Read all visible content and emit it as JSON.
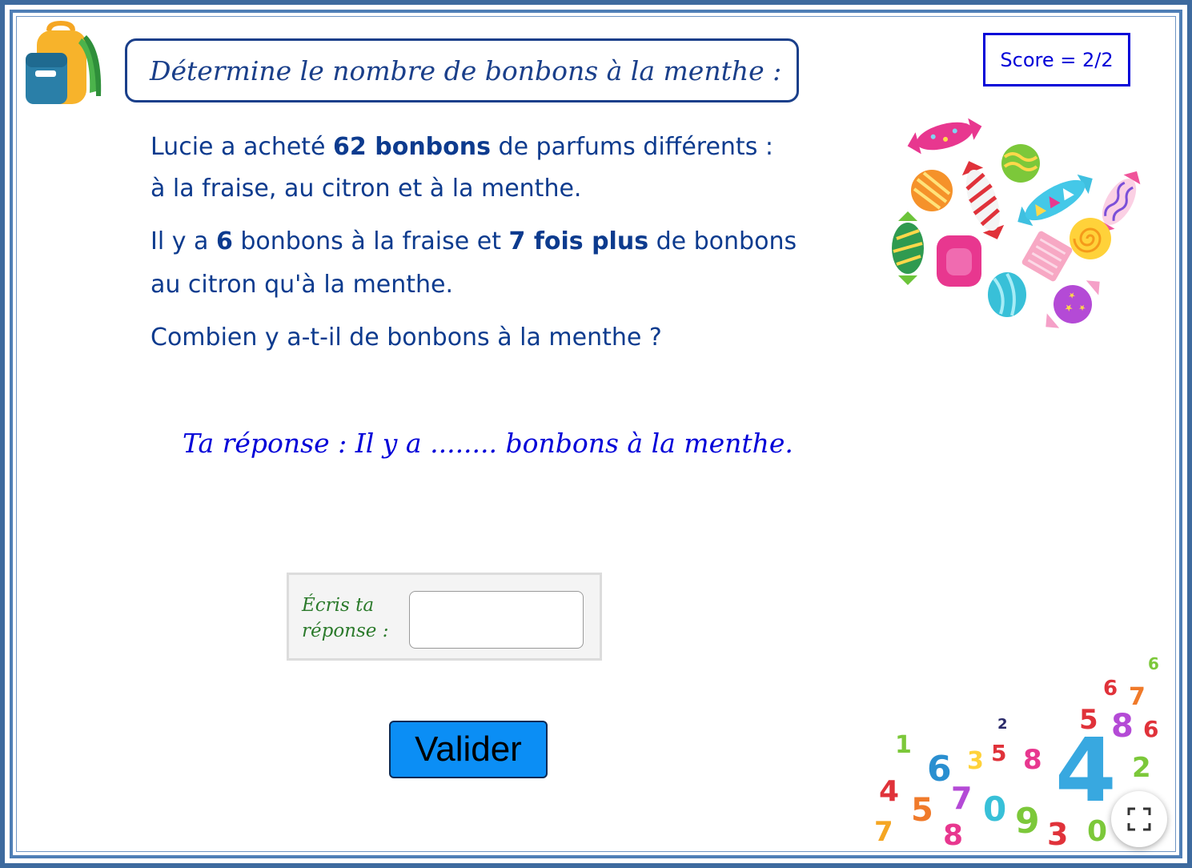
{
  "header": {
    "title": "Détermine le nombre de bonbons à la menthe :"
  },
  "score": {
    "label": "Score = 2/2"
  },
  "problem": {
    "line1_pre": "Lucie a acheté ",
    "line1_bold": "62 bonbons",
    "line1_post": " de parfums différents :",
    "line2": "à la fraise, au citron et à la menthe.",
    "line3_pre": "Il y a ",
    "line3_bold1": "6",
    "line3_mid": " bonbons à la fraise et ",
    "line3_bold2": "7 fois plus",
    "line3_post": " de bonbons",
    "line4": "au citron qu'à la menthe.",
    "line5": "Combien y a-t-il de bonbons à la menthe ?"
  },
  "answer_sentence": "Ta réponse : Il y a ........ bonbons à la menthe.",
  "input": {
    "label_line1": "Écris ta",
    "label_line2": "réponse :",
    "value": ""
  },
  "buttons": {
    "validate_label": "Valider"
  },
  "icons": {
    "backpack": "backpack-icon",
    "candies": "candies-illustration",
    "numbers": "numbers-pile-illustration",
    "fullscreen": "fullscreen-icon"
  },
  "colors": {
    "frame": "#3d6a9e",
    "title_text": "#1a3f8a",
    "score_text": "#0000d8",
    "problem_text": "#0d3b8e",
    "answer_text": "#0000d8",
    "input_label": "#2b7a2b",
    "validate_button": "#0b8ef5"
  }
}
